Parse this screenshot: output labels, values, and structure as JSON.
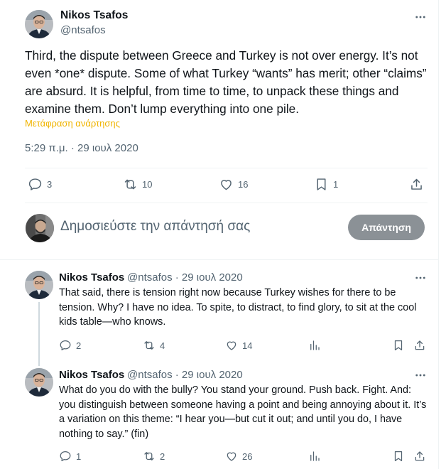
{
  "main_tweet": {
    "author_name": "Nikos Tsafos",
    "author_handle": "@ntsafos",
    "text": "Third, the dispute between Greece and Turkey is not over energy. It’s not even *one* dispute. Some of what Turkey “wants” has merit; other “claims” are absurd. It is helpful, from time to time, to unpack these things and examine them. Don’t lump everything into one pile.",
    "translate_label": "Μετάφραση ανάρτησης",
    "timestamp": "5:29 π.μ. · 29 ιουλ 2020",
    "replies": "3",
    "reposts": "10",
    "likes": "16",
    "bookmarks": "1"
  },
  "composer": {
    "placeholder": "Δημοσιεύστε την απάντησή σας",
    "reply_button": "Απάντηση"
  },
  "thread": [
    {
      "author_name": "Nikos Tsafos",
      "meta": "@ntsafos · 29 ιουλ 2020",
      "text": "That said, there is tension right now because Turkey wishes for there to be tension. Why? I have no idea. To spite, to distract, to find glory, to sit at the cool kids table—who knows.",
      "replies": "2",
      "reposts": "4",
      "likes": "14"
    },
    {
      "author_name": "Nikos Tsafos",
      "meta": "@ntsafos · 29 ιουλ 2020",
      "text": "What do you do with the bully? You stand your ground. Push back. Fight. And: you distinguish between someone having a point and being annoying about it. It’s a variation on this theme: “I hear you—but cut it out; and until you do, I have nothing to say.” (fin)",
      "replies": "1",
      "reposts": "2",
      "likes": "26"
    }
  ],
  "icons": {
    "more": "more-dots-icon",
    "reply": "reply-bubble-icon",
    "repost": "repost-arrows-icon",
    "like": "heart-icon",
    "bookmark": "bookmark-icon",
    "share": "share-upload-icon",
    "views": "views-bars-icon"
  },
  "colors": {
    "text": "#0f1419",
    "secondary": "#536471",
    "translate": "#f0b400",
    "reply_button_bg": "#8b9196",
    "divider": "#eff3f4"
  }
}
